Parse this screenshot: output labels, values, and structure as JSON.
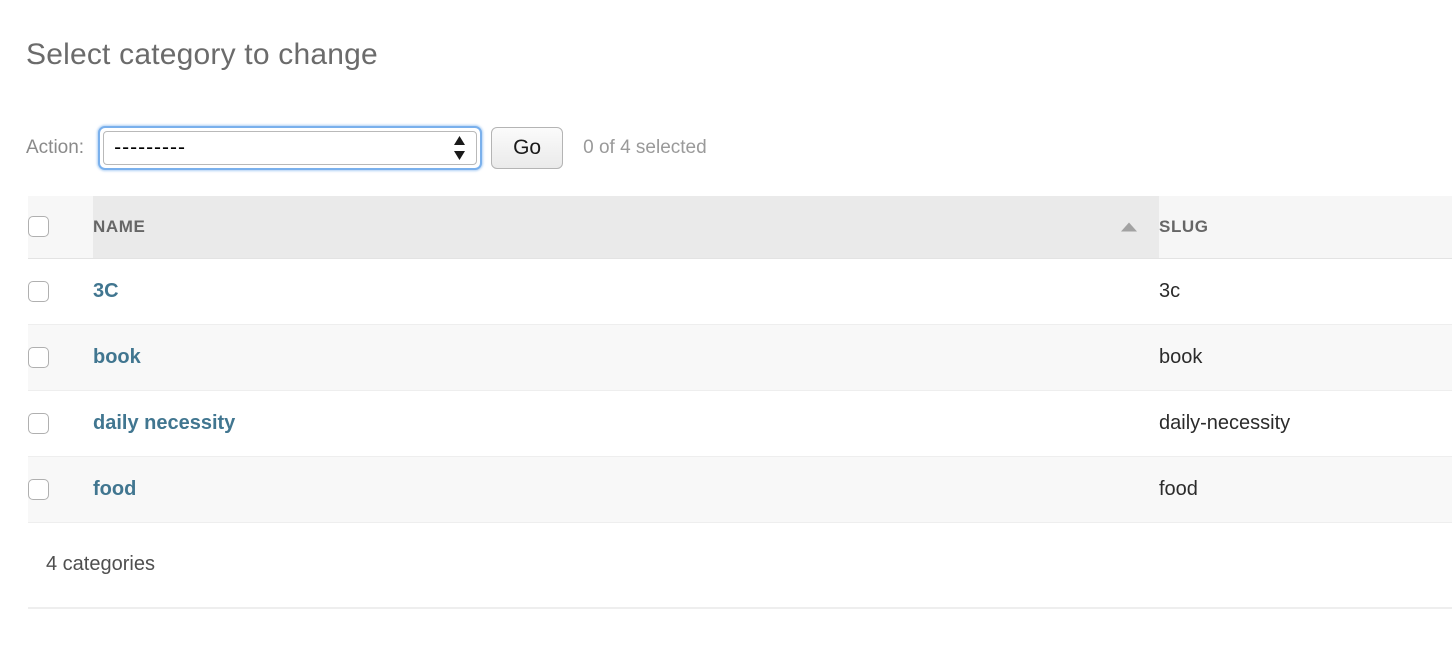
{
  "page": {
    "title": "Select category to change"
  },
  "actions": {
    "label": "Action:",
    "select_value": "---------",
    "select_options": [
      "---------"
    ],
    "go_label": "Go",
    "selection_count": "0 of 4 selected",
    "focus_ring_color": "#7ab0ec"
  },
  "table": {
    "columns": [
      {
        "key": "check",
        "label": ""
      },
      {
        "key": "name",
        "label": "NAME",
        "sorted": "asc"
      },
      {
        "key": "slug",
        "label": "SLUG",
        "sorted": "none"
      }
    ],
    "rows": [
      {
        "name": "3C",
        "slug": "3c"
      },
      {
        "name": "book",
        "slug": "book"
      },
      {
        "name": "daily necessity",
        "slug": "daily-necessity"
      },
      {
        "name": "food",
        "slug": "food"
      }
    ],
    "link_color": "#417690"
  },
  "footer": {
    "result_count": "4 categories"
  }
}
